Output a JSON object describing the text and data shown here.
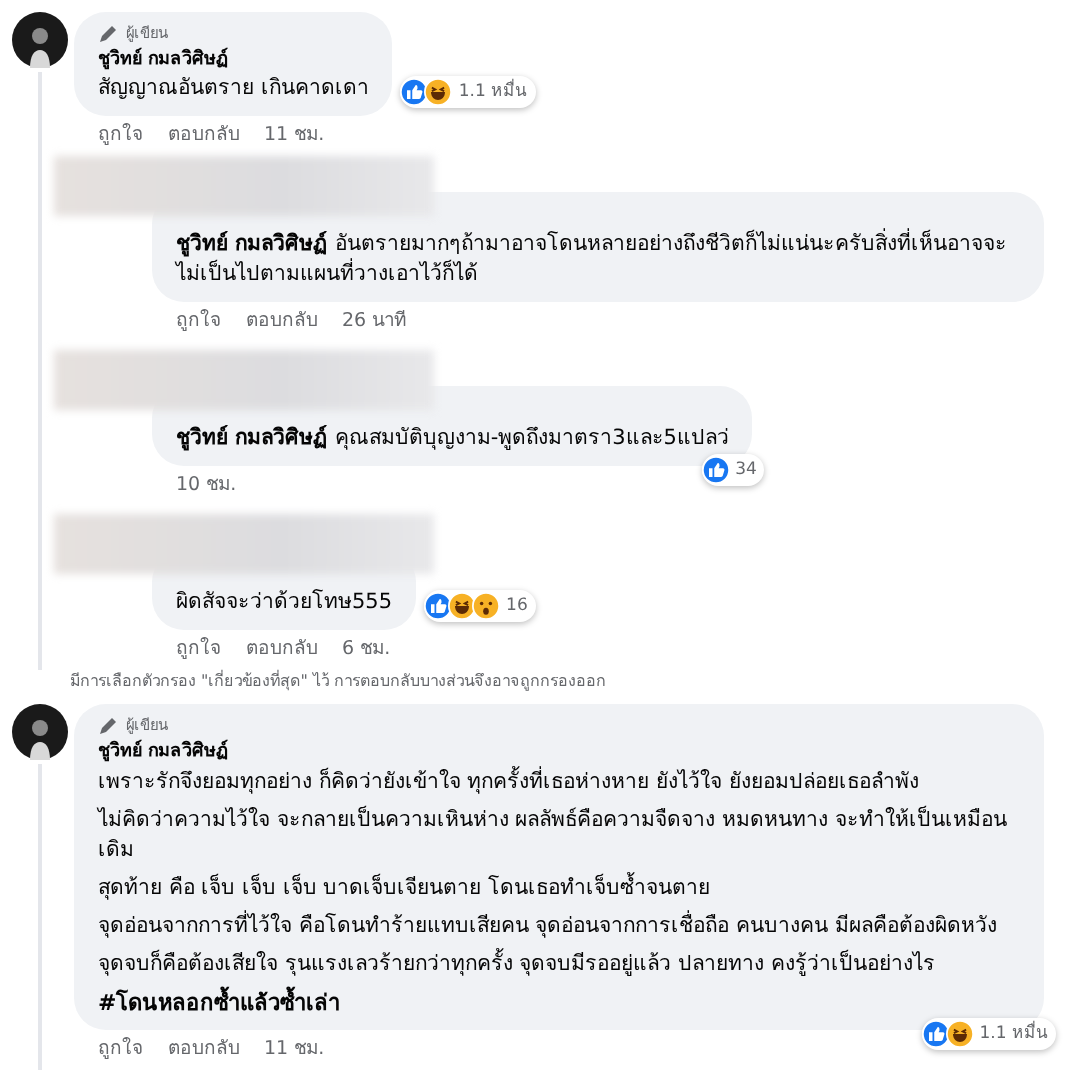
{
  "comments": [
    {
      "author_badge": "ผู้เขียน",
      "author": "ชูวิทย์ กมลวิศิษฏ์",
      "paragraphs": [
        "สัญญาณอันตราย เกินคาดเดา"
      ],
      "reactions": {
        "icons": [
          {
            "kind": "like"
          },
          {
            "kind": "haha"
          }
        ],
        "count": "1.1 หมื่น",
        "corner": false
      },
      "actions": [
        "ถูกใจ",
        "ตอบกลับ"
      ],
      "time": "11 ชม.",
      "replies": [
        {
          "redacted": true,
          "author": "ชูวิทย์ กมลวิศิษฏ์",
          "text": "อันตรายมากๆถ้ามาอาจโดนหลายอย่างถึงชีวิตก็ไม่แน่นะครับสิ่งที่เห็นอาจจะไม่เป็นไปตามแผนที่วางเอาไว้ก็ได้",
          "actions": [
            "ถูกใจ",
            "ตอบกลับ"
          ],
          "time": "26 นาที"
        },
        {
          "redacted": true,
          "author": "ชูวิทย์ กมลวิศิษฏ์",
          "text": "คุณสมบัติบุญงาม-พูดถึงมาตรา3และ5แปลว่",
          "reactions": {
            "icons": [
              {
                "kind": "like"
              }
            ],
            "count": "34",
            "corner": true
          },
          "time": "10 ชม."
        },
        {
          "redacted": true,
          "text": "ผิดสัจจะว่าด้วยโทษ555",
          "reactions": {
            "icons": [
              {
                "kind": "like"
              },
              {
                "kind": "haha"
              },
              {
                "kind": "wow"
              }
            ],
            "count": "16",
            "corner": false
          },
          "actions": [
            "ถูกใจ",
            "ตอบกลับ"
          ],
          "time": "6 ชม."
        }
      ]
    }
  ],
  "filter_note": "มีการเลือกตัวกรอง \"เกี่ยวข้องที่สุด\" ไว้ การตอบกลับบางส่วนจึงอาจถูกกรองออก",
  "comments_after": [
    {
      "author_badge": "ผู้เขียน",
      "author": "ชูวิทย์ กมลวิศิษฏ์",
      "paragraphs": [
        "เพราะรักจึงยอมทุกอย่าง ก็คิดว่ายังเข้าใจ ทุกครั้งที่เธอห่างหาย ยังไว้ใจ ยังยอมปล่อยเธอลำพัง",
        "ไม่คิดว่าความไว้ใจ จะกลายเป็นความเหินห่าง ผลลัพธ์คือความจืดจาง หมดหนทาง จะทำให้เป็นเหมือนเดิม",
        "สุดท้าย คือ เจ็บ เจ็บ เจ็บ บาดเจ็บเจียนตาย โดนเธอทำเจ็บซ้ำจนตาย",
        "จุดอ่อนจากการที่ไว้ใจ คือโดนทำร้ายแทบเสียคน จุดอ่อนจากการเชื่อถือ คนบางคน มีผลคือต้องผิดหวัง",
        "จุดจบก็คือต้องเสียใจ รุนแรงเลวร้ายกว่าทุกครั้ง จุดจบมีรออยู่แล้ว ปลายทาง คงรู้ว่าเป็นอย่างไร"
      ],
      "hashtag": "#โดนหลอกซ้ำแล้วซ้ำเล่า",
      "reactions": {
        "icons": [
          {
            "kind": "like"
          },
          {
            "kind": "haha"
          }
        ],
        "count": "1.1 หมื่น",
        "corner": true
      },
      "actions": [
        "ถูกใจ",
        "ตอบกลับ"
      ],
      "time": "11 ชม."
    }
  ]
}
